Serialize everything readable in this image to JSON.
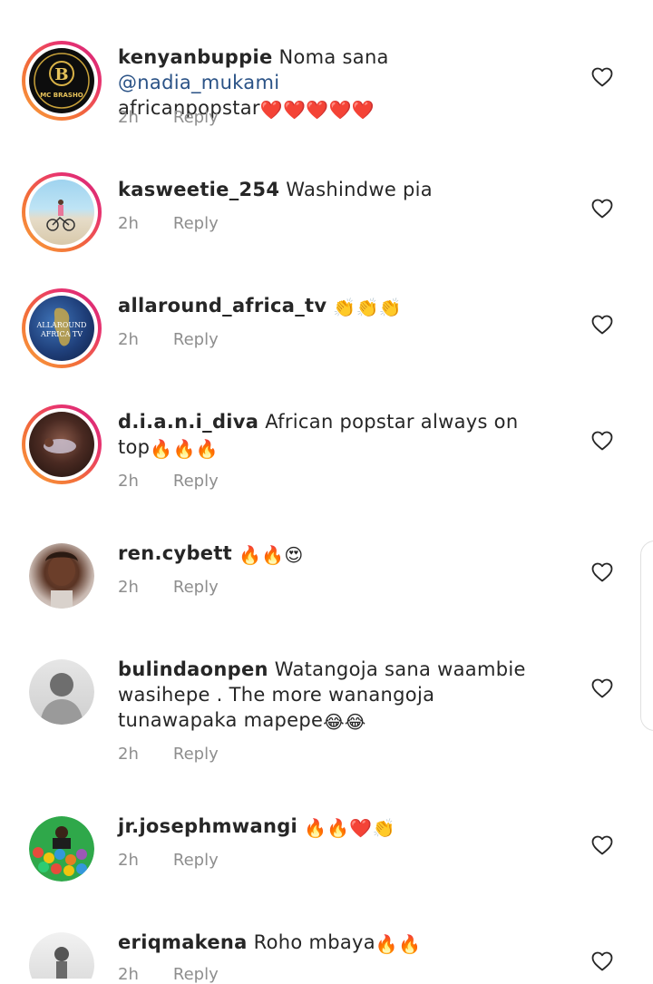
{
  "comments": [
    {
      "username": "kenyanbuppie",
      "text_before": "Noma sana ",
      "mention": "@nadia_mukami",
      "text_after": "africanpopstar",
      "emojis": "❤️❤️❤️❤️❤️",
      "time": "2h",
      "reply_label": "Reply",
      "avatar_text_top": "B",
      "avatar_text_bottom": "MC BRASHO"
    },
    {
      "username": "kasweetie_254",
      "text": "Washindwe pia",
      "emojis": "",
      "time": "2h",
      "reply_label": "Reply"
    },
    {
      "username": "allaround_africa_tv",
      "text": "",
      "emojis": "👏👏👏",
      "time": "2h",
      "reply_label": "Reply",
      "avatar_text_line1": "ALLAROUND",
      "avatar_text_line2": "AFRICA TV"
    },
    {
      "username": "d.i.a.n.i_diva",
      "text": "African popstar always on top",
      "emojis": "🔥🔥🔥",
      "time": "2h",
      "reply_label": "Reply"
    },
    {
      "username": "ren.cybett",
      "text": "",
      "emojis": "🔥🔥😍",
      "time": "2h",
      "reply_label": "Reply"
    },
    {
      "username": "bulindaonpen",
      "text": "Watangoja sana waambie wasihepe . The more wanangoja tunawapaka mapepe",
      "emojis": "😂😂",
      "time": "2h",
      "reply_label": "Reply"
    },
    {
      "username": "jr.josephmwangi",
      "text": "",
      "emojis": "🔥🔥❤️👏",
      "time": "2h",
      "reply_label": "Reply"
    },
    {
      "username": "eriqmakena",
      "text": "Roho mbaya",
      "emojis": "🔥🔥",
      "time": "2h",
      "reply_label": "Reply"
    }
  ],
  "colors": {
    "username": "#262626",
    "mention": "#2a5286",
    "meta": "#8e8e8e",
    "story_ring_start": "#f9a13a",
    "story_ring_end": "#d4247a"
  },
  "icons": {
    "like": "heart-outline-icon"
  }
}
